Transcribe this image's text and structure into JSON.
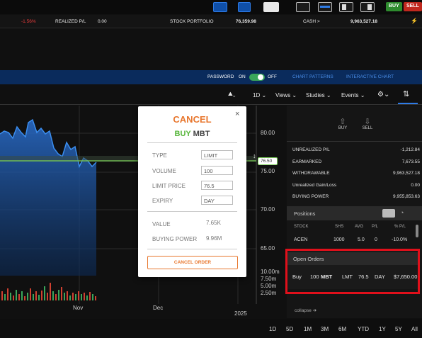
{
  "toolbar": {
    "buy_label": "BUY",
    "sell_label": "SELL"
  },
  "ticker": {
    "change": "-1.56%",
    "realized_label": "REALIZED P/L",
    "realized_value": "0.00",
    "portfolio_label": "STOCK PORTFOLIO",
    "portfolio_value": "76,359.98",
    "cash_label": "CASH >",
    "cash_value": "9,963,527.18"
  },
  "bluebar": {
    "password_label": "PASSWORD",
    "on_label": "ON",
    "off_label": "OFF",
    "chart_patterns": "CHART PATTERNS",
    "interactive_chart": "INTERACTIVE CHART"
  },
  "chart_tools": {
    "interval": "1D",
    "views": "Views",
    "studies": "Studies",
    "events": "Events"
  },
  "chart": {
    "y_ticks": [
      "80.00",
      "75.00",
      "70.00",
      "65.00"
    ],
    "price_marker": "76.50",
    "volume_ticks": [
      "10.00m",
      "7.50m",
      "5.00m",
      "2.50m"
    ],
    "x_ticks": [
      "Nov",
      "Dec",
      "2025"
    ]
  },
  "right_panel": {
    "buy_label": "BUY",
    "sell_label": "SELL",
    "account": [
      {
        "label": "UNREALIZED P/L",
        "value": "-1,212.84"
      },
      {
        "label": "EARMARKED",
        "value": "7,673.55"
      },
      {
        "label": "WITHDRAWABLE",
        "value": "9,963,527.18"
      },
      {
        "label": "Unrealized Gain/Loss",
        "value": "0.00"
      },
      {
        "label": "BUYING POWER",
        "value": "9,955,853.63"
      }
    ],
    "positions_title": "Positions",
    "positions_headers": [
      "STOCK",
      "SHS",
      "AVG",
      "P/L",
      "% P/L"
    ],
    "position_row": [
      "ACEN",
      "1000",
      "5.0",
      "0",
      "-10.0%"
    ],
    "open_orders_title": "Open Orders",
    "order": {
      "side": "Buy",
      "qty": "100",
      "symbol": "MBT",
      "type": "LMT",
      "price": "76.5",
      "tif": "DAY",
      "value": "$7,650.00"
    },
    "collapse_label": "collapse"
  },
  "ranges": [
    "1D",
    "5D",
    "1M",
    "3M",
    "6M",
    "YTD",
    "1Y",
    "5Y",
    "All"
  ],
  "modal": {
    "title": "CANCEL",
    "side": "BUY",
    "symbol": "MBT",
    "type_label": "TYPE",
    "type_value": "LIMIT",
    "volume_label": "VOLUME",
    "volume_value": "100",
    "limit_label": "LIMIT PRICE",
    "limit_value": "76.5",
    "expiry_label": "EXPIRY",
    "expiry_value": "DAY",
    "value_label": "VALUE",
    "value_value": "7.65K",
    "bp_label": "BUYING POWER",
    "bp_value": "9.96M",
    "cancel_order_label": "CANCEL ORDER",
    "close_icon": "×"
  },
  "colors": {
    "accent_orange": "#e8772e",
    "buy_green": "#56b63a",
    "sell_red": "#c0281e",
    "highlight_red": "#e0101b",
    "chart_blue": "#2a6fd0"
  }
}
